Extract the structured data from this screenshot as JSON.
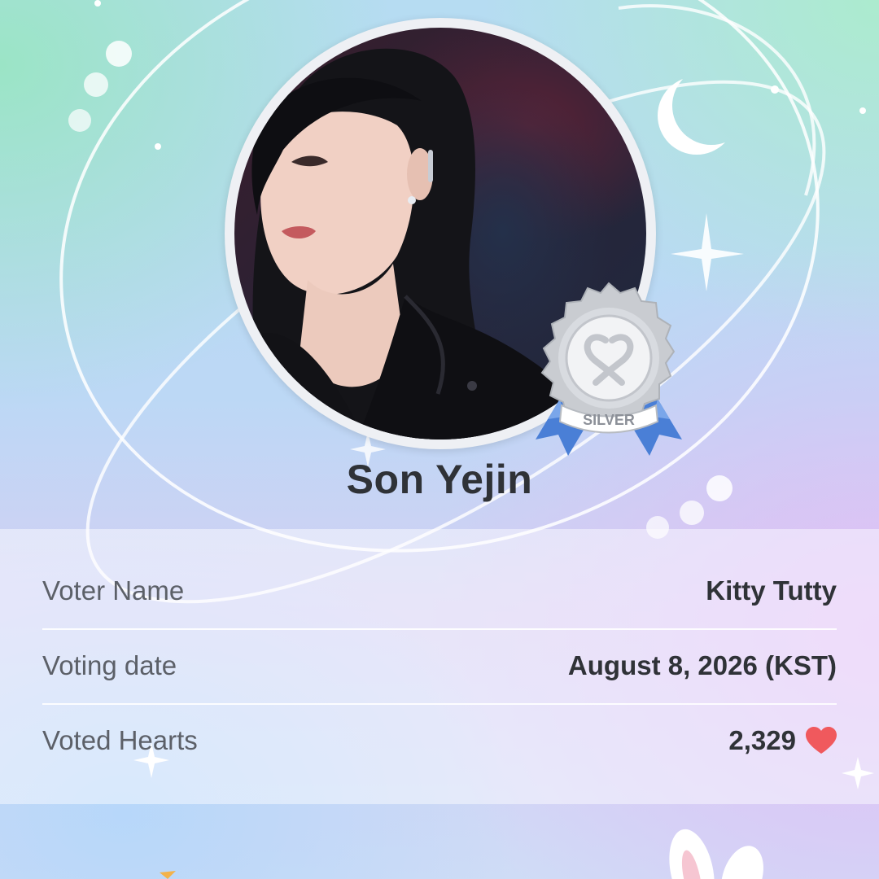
{
  "artist": {
    "name": "Son Yejin",
    "photo_icon": "portrait-photo",
    "badge": {
      "label": "SILVER",
      "emblem_icon": "heart-ribbon-icon",
      "colors": {
        "metal": "#c9ccd1",
        "ribbon": "#4a7fd6"
      }
    }
  },
  "vote_info": {
    "rows": [
      {
        "label": "Voter Name",
        "value": "Kitty Tutty"
      },
      {
        "label": "Voting date",
        "value": "August 8, 2026 (KST)"
      },
      {
        "label": "Voted Hearts",
        "value": "2,329",
        "icon": "heart-icon"
      }
    ]
  },
  "colors": {
    "heart": "#f0595d",
    "text_primary": "#2f3237",
    "text_secondary": "#5c6068"
  },
  "decorations": [
    "orbit-rings",
    "crescent-moon-icon",
    "sparkle-icon",
    "bunny-ears-icon"
  ]
}
